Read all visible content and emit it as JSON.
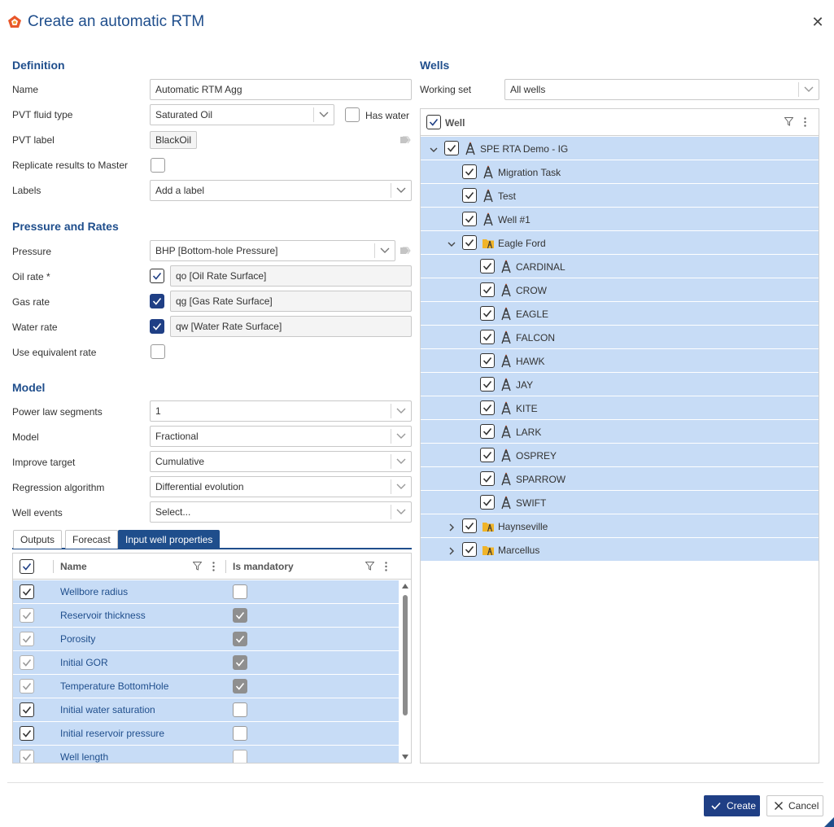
{
  "dialog": {
    "title": "Create an automatic RTM"
  },
  "definition": {
    "heading": "Definition",
    "name_label": "Name",
    "name_value": "Automatic RTM Agg",
    "pvt_fluid_label": "PVT fluid type",
    "pvt_fluid_value": "Saturated Oil",
    "has_water_label": "Has water",
    "pvt_label_label": "PVT label",
    "pvt_label_value": "BlackOil",
    "replicate_label": "Replicate results to Master",
    "labels_label": "Labels",
    "labels_placeholder": "Add a label"
  },
  "pressure_rates": {
    "heading": "Pressure and Rates",
    "pressure_label": "Pressure",
    "pressure_value": "BHP [Bottom-hole Pressure]",
    "oil_label": "Oil rate *",
    "oil_value": "qo [Oil Rate Surface]",
    "gas_label": "Gas rate",
    "gas_value": "qg [Gas Rate Surface]",
    "water_label": "Water rate",
    "water_value": "qw [Water Rate Surface]",
    "equiv_label": "Use equivalent rate"
  },
  "model": {
    "heading": "Model",
    "segments_label": "Power law segments",
    "segments_value": "1",
    "model_label": "Model",
    "model_value": "Fractional",
    "improve_label": "Improve target",
    "improve_value": "Cumulative",
    "regression_label": "Regression algorithm",
    "regression_value": "Differential evolution",
    "events_label": "Well events",
    "events_placeholder": "Select..."
  },
  "tabs": [
    "Outputs",
    "Forecast",
    "Input well properties"
  ],
  "properties_grid": {
    "col_name": "Name",
    "col_mandatory": "Is mandatory",
    "rows": [
      {
        "name": "Wellbore radius",
        "selected": true,
        "mandatory": false,
        "locked": false
      },
      {
        "name": "Reservoir thickness",
        "selected": true,
        "mandatory": true,
        "locked": true
      },
      {
        "name": "Porosity",
        "selected": true,
        "mandatory": true,
        "locked": true
      },
      {
        "name": "Initial GOR",
        "selected": true,
        "mandatory": true,
        "locked": true
      },
      {
        "name": "Temperature BottomHole",
        "selected": true,
        "mandatory": true,
        "locked": true
      },
      {
        "name": "Initial water saturation",
        "selected": true,
        "mandatory": false,
        "locked": false
      },
      {
        "name": "Initial reservoir pressure",
        "selected": true,
        "mandatory": false,
        "locked": false
      },
      {
        "name": "Well length",
        "selected": true,
        "mandatory": false,
        "locked": true
      }
    ]
  },
  "wells": {
    "heading": "Wells",
    "working_set_label": "Working set",
    "working_set_value": "All wells",
    "tree_header": "Well",
    "rows": [
      {
        "label": "SPE RTA Demo - IG",
        "level": 0,
        "type": "well",
        "expand": "open"
      },
      {
        "label": "Migration Task",
        "level": 1,
        "type": "well",
        "expand": "none"
      },
      {
        "label": "Test",
        "level": 1,
        "type": "well",
        "expand": "none"
      },
      {
        "label": "Well #1",
        "level": 1,
        "type": "well",
        "expand": "none"
      },
      {
        "label": "Eagle Ford",
        "level": 1,
        "type": "folder",
        "expand": "open"
      },
      {
        "label": "CARDINAL",
        "level": 2,
        "type": "well",
        "expand": "none"
      },
      {
        "label": "CROW",
        "level": 2,
        "type": "well",
        "expand": "none"
      },
      {
        "label": "EAGLE",
        "level": 2,
        "type": "well",
        "expand": "none"
      },
      {
        "label": "FALCON",
        "level": 2,
        "type": "well",
        "expand": "none"
      },
      {
        "label": "HAWK",
        "level": 2,
        "type": "well",
        "expand": "none"
      },
      {
        "label": "JAY",
        "level": 2,
        "type": "well",
        "expand": "none"
      },
      {
        "label": "KITE",
        "level": 2,
        "type": "well",
        "expand": "none"
      },
      {
        "label": "LARK",
        "level": 2,
        "type": "well",
        "expand": "none"
      },
      {
        "label": "OSPREY",
        "level": 2,
        "type": "well",
        "expand": "none"
      },
      {
        "label": "SPARROW",
        "level": 2,
        "type": "well",
        "expand": "none"
      },
      {
        "label": "SWIFT",
        "level": 2,
        "type": "well",
        "expand": "none"
      },
      {
        "label": "Haynseville",
        "level": 1,
        "type": "folder",
        "expand": "closed"
      },
      {
        "label": "Marcellus",
        "level": 1,
        "type": "folder",
        "expand": "closed"
      }
    ]
  },
  "footer": {
    "create_label": "Create",
    "cancel_label": "Cancel"
  },
  "colors": {
    "accent": "#1f4e8c",
    "button": "#1f3f85",
    "row_highlight": "#c7dcf6",
    "folder": "#f0b429"
  }
}
